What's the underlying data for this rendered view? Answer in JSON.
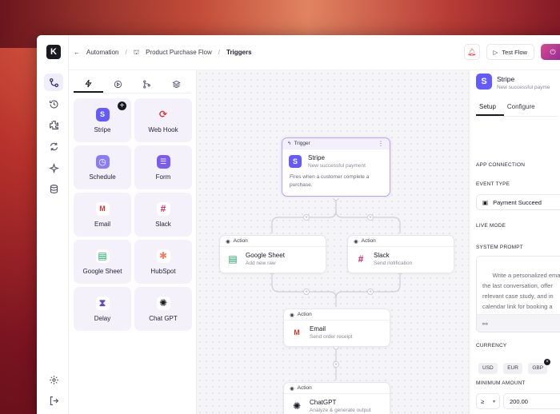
{
  "header": {
    "back_label": "Automation",
    "flow_label": "Product Purchase Flow",
    "current": "Triggers",
    "test_flow_label": "Test Flow"
  },
  "palette": {
    "items": [
      {
        "label": "Stripe",
        "icon": "stripe-icon",
        "color": "#635bff",
        "glyph": "S"
      },
      {
        "label": "Web Hook",
        "icon": "webhook-icon",
        "color": "#ffffff",
        "glyph": "⟳"
      },
      {
        "label": "Schedule",
        "icon": "clock-icon",
        "color": "#8b7cf6",
        "glyph": "◷"
      },
      {
        "label": "Form",
        "icon": "form-icon",
        "color": "#7c5cf0",
        "glyph": "☰"
      },
      {
        "label": "Email",
        "icon": "gmail-icon",
        "color": "#ffffff",
        "glyph": "M"
      },
      {
        "label": "Slack",
        "icon": "slack-icon",
        "color": "#ffffff",
        "glyph": "#"
      },
      {
        "label": "Google Sheet",
        "icon": "google-sheet-icon",
        "color": "#1fa463",
        "glyph": "▤"
      },
      {
        "label": "HubSpot",
        "icon": "hubspot-icon",
        "color": "#ffffff",
        "glyph": "✱"
      },
      {
        "label": "Delay",
        "icon": "hourglass-icon",
        "color": "#ffffff",
        "glyph": "⧗"
      },
      {
        "label": "Chat GPT",
        "icon": "chatgpt-icon",
        "color": "#ffffff",
        "glyph": "✺"
      }
    ]
  },
  "canvas": {
    "trigger": {
      "badge": "Trigger",
      "title": "Stripe",
      "subtitle": "New successful payment",
      "description_line1": "Fires when a customer complete a",
      "description_line2": "purchase."
    },
    "actions": [
      {
        "badge": "Action",
        "title": "Google Sheet",
        "subtitle": "Add new raw"
      },
      {
        "badge": "Action",
        "title": "Slack",
        "subtitle": "Send notification"
      },
      {
        "badge": "Action",
        "title": "Email",
        "subtitle": "Send order receipt"
      },
      {
        "badge": "Action",
        "title": "ChatGPT",
        "subtitle": "Analyze & generate output"
      }
    ]
  },
  "panel": {
    "title": "Stripe",
    "subtitle": "New successful payme",
    "tabs": [
      "Setup",
      "Configure"
    ],
    "app_connection_label": "APP CONNECTION",
    "event_type_label": "EVENT TYPE",
    "event_type_value": "Payment Succeed",
    "live_mode_label": "LIVE MODE",
    "system_prompt_label": "SYSTEM PROMPT",
    "system_prompt_text": "Write a personalized email\nthe last conversation, offer\nrelevant case study, and in\ncalendar link for booking a\na friendly but professional t",
    "currency_label": "CURRENCY",
    "currencies": [
      "USD",
      "EUR",
      "GBP"
    ],
    "minimum_amount_label": "MINIMUM AMOUNT",
    "operator": "≥",
    "minimum_amount_value": "200.00"
  }
}
